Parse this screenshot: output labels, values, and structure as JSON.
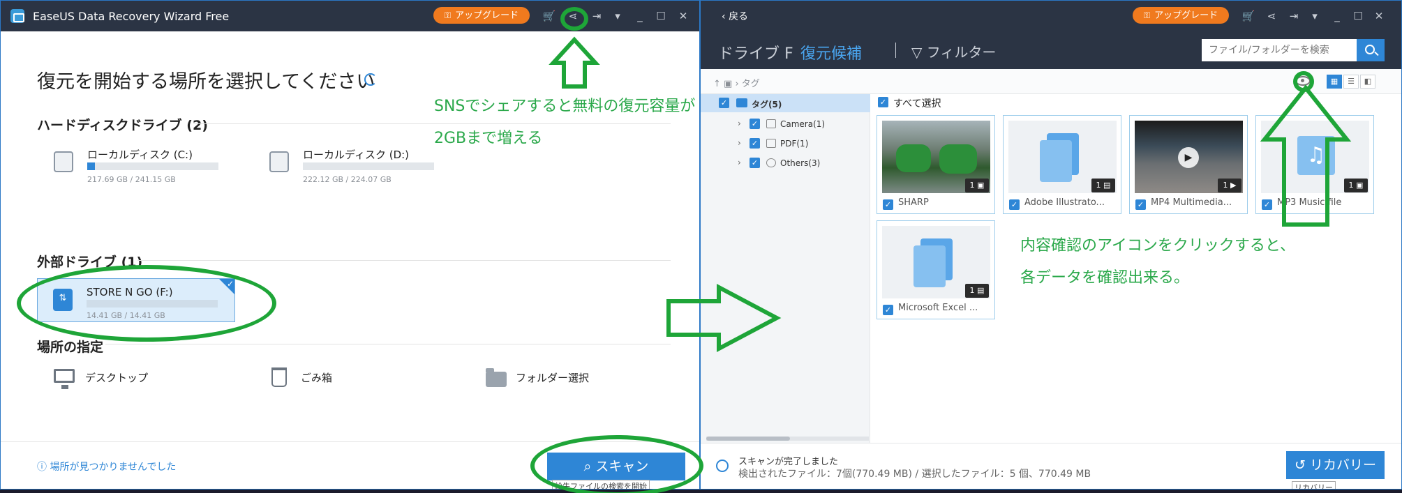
{
  "left_window": {
    "title": "EaseUS Data Recovery Wizard Free",
    "upgrade_label": "アップグレード",
    "page_title": "復元を開始する場所を選択してください",
    "hdd_section": "ハードディスクドライブ (2)",
    "drives": [
      {
        "name": "ローカルディスク (C:)",
        "size": "217.69 GB / 241.15 GB",
        "usage": 0.06
      },
      {
        "name": "ローカルディスク (D:)",
        "size": "222.12 GB / 224.07 GB",
        "usage": 0.0
      }
    ],
    "ext_section": "外部ドライブ (1)",
    "external_drive": {
      "name": "STORE N GO (F:)",
      "size": "14.41 GB / 14.41 GB"
    },
    "location_section": "場所の指定",
    "locations": [
      "デスクトップ",
      "ごみ箱",
      "フォルダー選択"
    ],
    "help_link": "場所が見つかりませんでした",
    "scan_label": "スキャン",
    "scan_tooltip": "紛失ファイルの検索を開始"
  },
  "right_window": {
    "back_label": "戻る",
    "upgrade_label": "アップグレード",
    "tabs": [
      "ドライブ F",
      "復元候補",
      "フィルター"
    ],
    "search_placeholder": "ファイル/フォルダーを検索",
    "path": "タグ",
    "tree": {
      "root": "タグ(5)",
      "children": [
        "Camera(1)",
        "PDF(1)",
        "Others(3)"
      ]
    },
    "select_all": "すべて選択",
    "files": [
      {
        "name": "SHARP",
        "count": "1"
      },
      {
        "name": "Adobe Illustrato...",
        "count": "1"
      },
      {
        "name": "MP4 Multimedia...",
        "count": "1"
      },
      {
        "name": "MP3 Music file",
        "count": "1"
      },
      {
        "name": "Microsoft Excel ...",
        "count": "1"
      }
    ],
    "status_title": "スキャンが完了しました",
    "status_detail": "検出されたファイル：7個(770.49 MB) / 選択したファイル：5  個、770.49 MB",
    "recover_label": "リカバリー",
    "recover_tooltip": "リカバリー"
  },
  "annotations": {
    "sns_line1": "SNSでシェアすると無料の復元容量が",
    "sns_line2": "2GBまで増える",
    "preview_line1": "内容確認のアイコンをクリックすると、",
    "preview_line2": "各データを確認出来る。"
  },
  "colors": {
    "accent": "#2e86d6",
    "titlebar": "#2b3444",
    "upgrade": "#f07a1e",
    "annotation": "#1ea538"
  }
}
